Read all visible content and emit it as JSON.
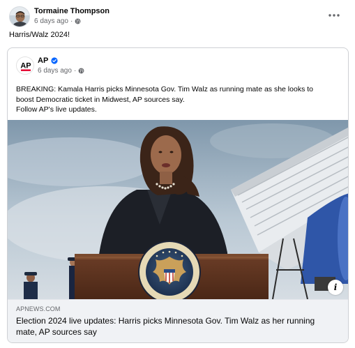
{
  "post": {
    "author_name": "Tormaine Thompson",
    "time": "6 days ago",
    "text": "Harris/Walz 2024!"
  },
  "shared": {
    "source_name": "AP",
    "logo_text": "AP",
    "time": "6 days ago",
    "text_lines": [
      "BREAKING: Kamala Harris picks Minnesota Gov. Tim Walz as running mate as she looks to",
      "boost Democratic ticket in Midwest, AP sources say.",
      "Follow AP's live updates."
    ]
  },
  "link": {
    "domain": "APNEWS.COM",
    "headline": "Election 2024 live updates: Harris picks Minnesota Gov. Tim Walz as her running mate, AP sources say"
  },
  "photo": {
    "info_glyph": "i",
    "seal_text": "PRESIDENT OF THE UNITED STATES"
  },
  "icons": {
    "more": "more-options-icon",
    "audience": "globe-icon",
    "verified": "verified-badge-icon",
    "info": "info-icon"
  },
  "colors": {
    "meta_gray": "#65676b",
    "verified_blue": "#0866ff",
    "ap_red": "#e4002b",
    "link_footer_bg": "#f0f2f5"
  }
}
